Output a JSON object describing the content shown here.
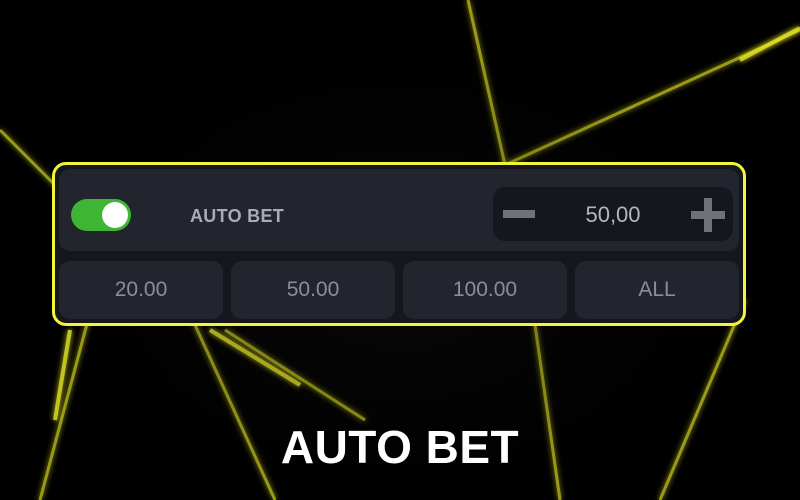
{
  "panel": {
    "auto_bet_label": "AUTO BET",
    "toggle_on": true,
    "amount": "50,00",
    "quick_amounts": [
      "20.00",
      "50.00",
      "100.00",
      "ALL"
    ]
  },
  "caption": "AUTO BET",
  "colors": {
    "accent_border": "#f1f53c",
    "toggle_on": "#3fb534",
    "panel_bg": "#15171c",
    "button_bg": "#22252d"
  }
}
